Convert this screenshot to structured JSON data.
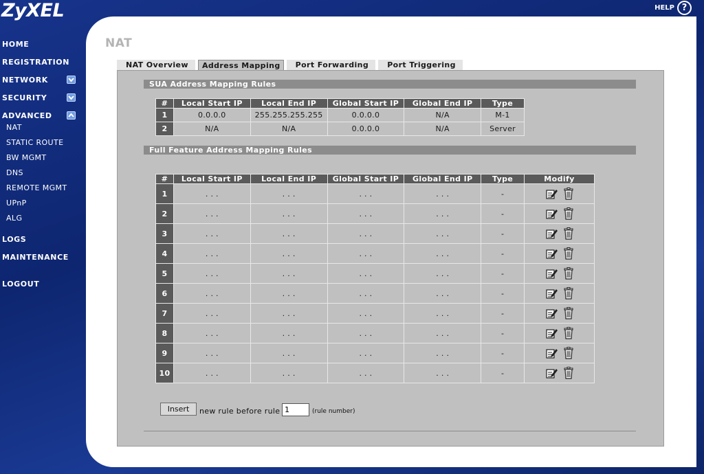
{
  "brand": {
    "logo": "ZyXEL",
    "help_label": "HELP",
    "help_icon": "help-circle-icon"
  },
  "sidebar": {
    "home": "HOME",
    "registration": "REGISTRATION",
    "network": "NETWORK",
    "security": "SECURITY",
    "advanced": "ADVANCED",
    "advanced_items": [
      "NAT",
      "STATIC ROUTE",
      "BW MGMT",
      "DNS",
      "REMOTE MGMT",
      "UPnP",
      "ALG"
    ],
    "logs": "LOGS",
    "maintenance": "MAINTENANCE",
    "logout": "LOGOUT"
  },
  "page": {
    "title": "NAT"
  },
  "tabs": [
    "NAT Overview",
    "Address Mapping",
    "Port Forwarding",
    "Port Triggering"
  ],
  "sua": {
    "title": "SUA Address Mapping Rules",
    "headers": [
      "#",
      "Local Start IP",
      "Local End IP",
      "Global Start IP",
      "Global End IP",
      "Type"
    ],
    "rows": [
      [
        "1",
        "0.0.0.0",
        "255.255.255.255",
        "0.0.0.0",
        "N/A",
        "M-1"
      ],
      [
        "2",
        "N/A",
        "N/A",
        "0.0.0.0",
        "N/A",
        "Server"
      ]
    ]
  },
  "full": {
    "title": "Full Feature Address Mapping Rules",
    "headers": [
      "#",
      "Local Start IP",
      "Local End IP",
      "Global Start IP",
      "Global End IP",
      "Type",
      "Modify"
    ],
    "rows": [
      [
        "1",
        ". . .",
        ". . .",
        ". . .",
        ". . .",
        "-"
      ],
      [
        "2",
        ". . .",
        ". . .",
        ". . .",
        ". . .",
        "-"
      ],
      [
        "3",
        ". . .",
        ". . .",
        ". . .",
        ". . .",
        "-"
      ],
      [
        "4",
        ". . .",
        ". . .",
        ". . .",
        ". . .",
        "-"
      ],
      [
        "5",
        ". . .",
        ". . .",
        ". . .",
        ". . .",
        "-"
      ],
      [
        "6",
        ". . .",
        ". . .",
        ". . .",
        ". . .",
        "-"
      ],
      [
        "7",
        ". . .",
        ". . .",
        ". . .",
        ". . .",
        "-"
      ],
      [
        "8",
        ". . .",
        ". . .",
        ". . .",
        ". . .",
        "-"
      ],
      [
        "9",
        ". . .",
        ". . .",
        ". . .",
        ". . .",
        "-"
      ],
      [
        "10",
        ". . .",
        ". . .",
        ". . .",
        ". . .",
        "-"
      ]
    ],
    "modify_icons": [
      "edit-icon",
      "trash-icon"
    ]
  },
  "insert": {
    "button_label": "Insert",
    "text": "new rule before rule",
    "value": "1",
    "hint": "(rule number)"
  },
  "colors": {
    "background": "#0f2a78",
    "header": "#5a5a5a",
    "content": "#c0c0c0"
  }
}
